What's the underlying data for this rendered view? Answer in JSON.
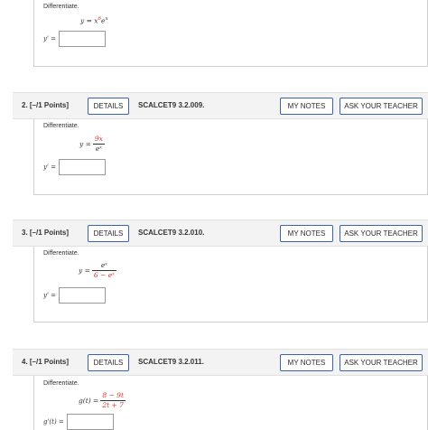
{
  "q1": {
    "instruction": "Differentiate.",
    "fn_lhs": "y =",
    "fn_parts": {
      "x": "x",
      "exp6": "6",
      "e": "e",
      "expx": "x"
    },
    "answer_label": "y' ="
  },
  "q2": {
    "header": {
      "number": "2.  [–/1 Points]",
      "details": "DETAILS",
      "code": "SCALCET9 3.2.009.",
      "notes": "MY NOTES",
      "teacher": "ASK YOUR TEACHER"
    },
    "instruction": "Differentiate.",
    "fn_lhs": "y =",
    "numerator": "9x",
    "denominator": "eˣ",
    "answer_label": "y' ="
  },
  "q3": {
    "header": {
      "number": "3.  [–/1 Points]",
      "details": "DETAILS",
      "code": "SCALCET9 3.2.010.",
      "notes": "MY NOTES",
      "teacher": "ASK YOUR TEACHER"
    },
    "instruction": "Differentiate.",
    "fn_lhs": "y =",
    "numerator": "eˣ",
    "denominator": "6 − eˣ",
    "answer_label": "y' ="
  },
  "q4": {
    "header": {
      "number": "4.  [–/1 Points]",
      "details": "DETAILS",
      "code": "SCALCET9 3.2.011.",
      "notes": "MY NOTES",
      "teacher": "ASK YOUR TEACHER"
    },
    "instruction": "Differentiate.",
    "fn_lhs": "g(t) =",
    "numerator": "8 − 9t",
    "denominator": "2t + 7",
    "answer_label": "g'(t) ="
  },
  "colors": {
    "accent_red": "#d0342c",
    "button_border": "#3a63a8",
    "header_bg": "#f3f3f3"
  }
}
